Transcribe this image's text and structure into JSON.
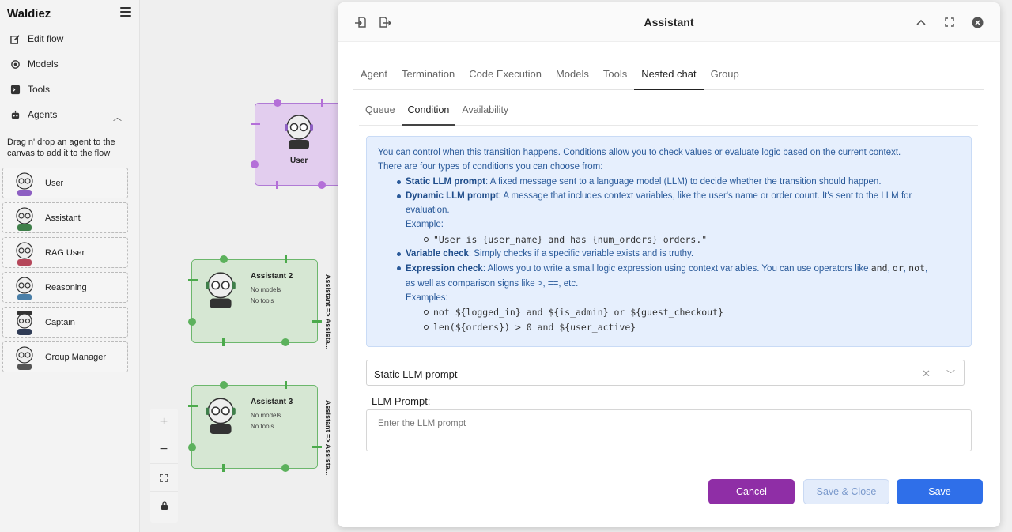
{
  "app": {
    "brand": "Waldiez"
  },
  "sidebar": {
    "items": [
      {
        "label": "Edit flow",
        "icon": "edit-icon"
      },
      {
        "label": "Models",
        "icon": "models-icon"
      },
      {
        "label": "Tools",
        "icon": "terminal-icon"
      },
      {
        "label": "Agents",
        "icon": "robot-icon"
      }
    ],
    "hint": "Drag n' drop an agent to the canvas to add it to the flow",
    "agents": [
      "User",
      "Assistant",
      "RAG User",
      "Reasoning",
      "Captain",
      "Group Manager"
    ]
  },
  "canvas": {
    "user_node": {
      "title": "User"
    },
    "nodes": [
      {
        "title": "Assistant 2",
        "models": "No models",
        "tools": "No tools",
        "edge": "Assistant => Assista..."
      },
      {
        "title": "Assistant 3",
        "models": "No models",
        "tools": "No tools",
        "edge": "Assistant => Assista..."
      }
    ],
    "controls": [
      "+",
      "−",
      "⛶",
      "🔒"
    ]
  },
  "modal": {
    "title": "Assistant",
    "tabs": [
      "Agent",
      "Termination",
      "Code Execution",
      "Models",
      "Tools",
      "Nested chat",
      "Group"
    ],
    "active_tab": "Nested chat",
    "subtabs": [
      "Queue",
      "Condition",
      "Availability"
    ],
    "active_subtab": "Condition",
    "info": {
      "intro1": "You can control when this transition happens. Conditions allow you to check values or evaluate logic based on the current context.",
      "intro2": "There are four types of conditions you can choose from:",
      "static_title": "Static LLM prompt",
      "static_desc": ": A fixed message sent to a language model (LLM) to decide whether the transition should happen.",
      "dynamic_title": "Dynamic LLM prompt",
      "dynamic_desc1": ": A message that includes context variables, like the user's name or order count. It's sent to the LLM for",
      "dynamic_desc2": "evaluation.",
      "example_label": "Example:",
      "example1": "\"User is {user_name} and has {num_orders} orders.\"",
      "variable_title": "Variable check",
      "variable_desc": ": Simply checks if a specific variable exists and is truthy.",
      "expression_title": "Expression check",
      "expression_desc1": ": Allows you to write a small logic expression using context variables. You can use operators like ",
      "op_and": "and",
      "op_or": "or",
      "op_not": "not",
      "expression_desc2": "as well as comparison signs like >, ==, etc.",
      "examples_label": "Examples:",
      "example2": "not ${logged_in} and ${is_admin} or ${guest_checkout}",
      "example3": "len(${orders}) > 0 and ${user_active}"
    },
    "condition_select": {
      "value": "Static LLM prompt"
    },
    "prompt": {
      "label": "LLM Prompt:",
      "placeholder": "Enter the LLM prompt"
    },
    "buttons": {
      "cancel": "Cancel",
      "save_close": "Save & Close",
      "save": "Save"
    }
  }
}
